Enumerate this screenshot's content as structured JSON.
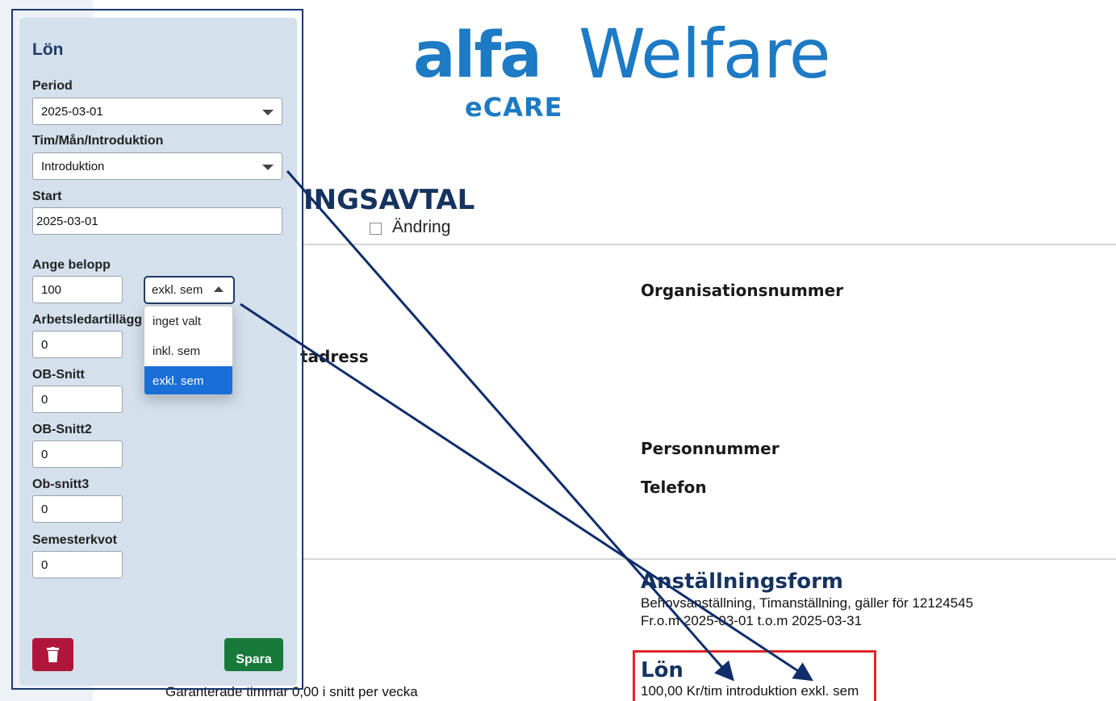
{
  "logo": {
    "part1": "alfa",
    "part2": "Welfare",
    "sub": "eCARE"
  },
  "document": {
    "title": "INGSAVTAL",
    "change_label": "Ändring",
    "org_label": "Organisationsnummer",
    "address_label": "tadress",
    "personnummer_label": "Personnummer",
    "telefon_label": "Telefon",
    "anstallningsform_heading": "Anställningsform",
    "anstallningsform_line1": "Behovsanställning, Timanställning, gäller för 12124545",
    "anstallningsform_line2": "Fr.o.m 2025-03-01 t.o.m 2025-03-31",
    "lon_heading": "Lön",
    "lon_text": "100,00 Kr/tim introduktion exkl. sem",
    "guaranteed_text": "Garanterade timmar 0,00 i snitt per vecka"
  },
  "panel": {
    "title": "Lön",
    "period_label": "Period",
    "period_value": "2025-03-01",
    "type_label": "Tim/Mån/Introduktion",
    "type_value": "Introduktion",
    "start_label": "Start",
    "start_value": "2025-03-01",
    "amount_label": "Ange belopp",
    "amount_value": "100",
    "sem_value": "exkl. sem",
    "sem_options": [
      "inget valt",
      "inkl. sem",
      "exkl. sem"
    ],
    "arbetsledar_label": "Arbetsledartillägg",
    "arbetsledar_value": "0",
    "ob1_label": "OB-Snitt",
    "ob1_value": "0",
    "ob2_label": "OB-Snitt2",
    "ob2_value": "0",
    "ob3_label": "Ob-snitt3",
    "ob3_value": "0",
    "semesterkvot_label": "Semesterkvot",
    "semesterkvot_value": "0",
    "save_label": "Spara"
  },
  "colors": {
    "brand": "#1d7ac4",
    "heading": "#16335f",
    "highlight_box": "#e0262b",
    "selected_option": "#1a6ed8",
    "save_button": "#177a3b",
    "delete_button": "#b0163c",
    "arrow": "#0f2d6b"
  },
  "icons": {
    "delete": "trash-icon",
    "select": "chevron-down-icon",
    "select_open": "chevron-up-icon"
  }
}
